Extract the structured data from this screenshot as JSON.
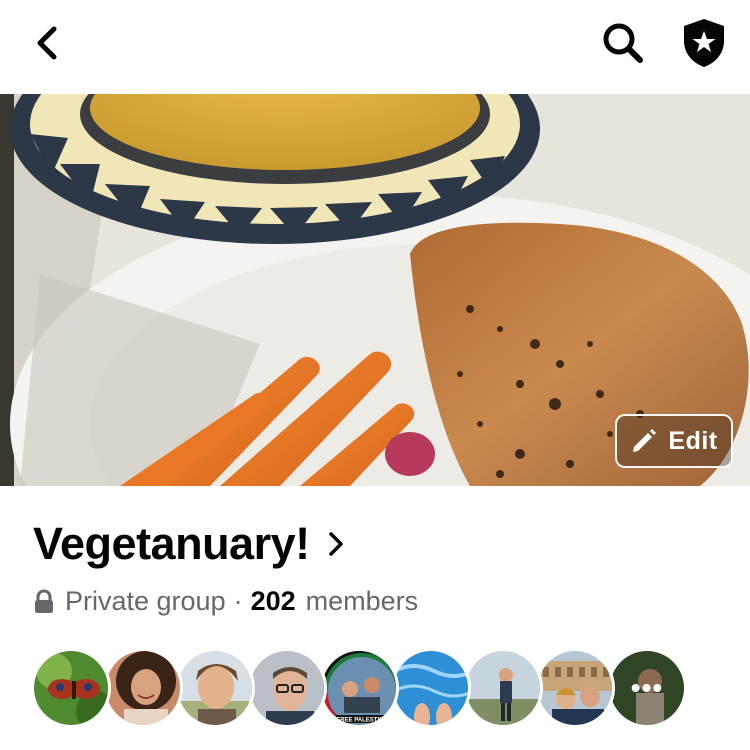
{
  "header": {
    "back_icon": "chevron-left-icon",
    "search_icon": "search-icon",
    "shield_icon": "shield-star-icon"
  },
  "cover": {
    "edit_label": "Edit",
    "edit_icon": "pencil-icon"
  },
  "group": {
    "name": "Vegetanuary!",
    "chevron_icon": "chevron-right-icon",
    "privacy": "Private group",
    "separator": "·",
    "member_count": "202",
    "members_label": "members",
    "lock_icon": "lock-icon"
  },
  "member_avatars": [
    {
      "name": "member-avatar-butterfly"
    },
    {
      "name": "member-avatar-woman-smiling"
    },
    {
      "name": "member-avatar-woman-outdoors"
    },
    {
      "name": "member-avatar-man-glasses"
    },
    {
      "name": "member-avatar-group-free-palestine",
      "badge_text": "FREE PALESTINE"
    },
    {
      "name": "member-avatar-pool-feet"
    },
    {
      "name": "member-avatar-person-field"
    },
    {
      "name": "member-avatar-couple-colosseum"
    },
    {
      "name": "member-avatar-more",
      "overlay": "•••"
    }
  ]
}
